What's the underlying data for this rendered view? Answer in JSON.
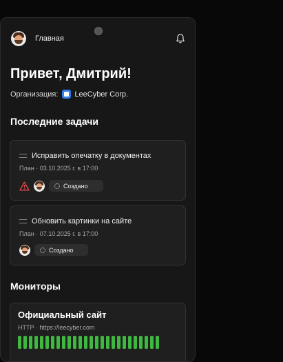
{
  "header": {
    "title": "Главная"
  },
  "greeting": "Привет, Дмитрий!",
  "organization": {
    "label": "Организация:",
    "name": "LeeCyber Corp."
  },
  "tasks_section": {
    "title": "Последние задачи",
    "tasks": [
      {
        "title": "Исправить опечатку в документах",
        "date": "План · 03.10.2025 г. в 17:00",
        "status": "Создано",
        "warning": true
      },
      {
        "title": "Обновить картинки на сайте",
        "date": "План · 07.10.2025 г. в 17:00",
        "status": "Создано",
        "warning": false
      }
    ]
  },
  "monitors_section": {
    "title": "Мониторы",
    "monitors": [
      {
        "name": "Официальный сайт",
        "url": "HTTP · https://leecyber.com",
        "uptime_bars": 26,
        "status_color": "#3fb83f"
      }
    ]
  },
  "icons": {
    "notifications": "bell-icon",
    "warning": "warning-triangle-icon",
    "status": "spinner-icon",
    "drag": "drag-handle-icon"
  },
  "colors": {
    "background": "#080808",
    "card": "#1f1f1f",
    "accent_warning": "#e5484d",
    "uptime_ok": "#3fb83f",
    "org_logo": "#2f80ed"
  }
}
